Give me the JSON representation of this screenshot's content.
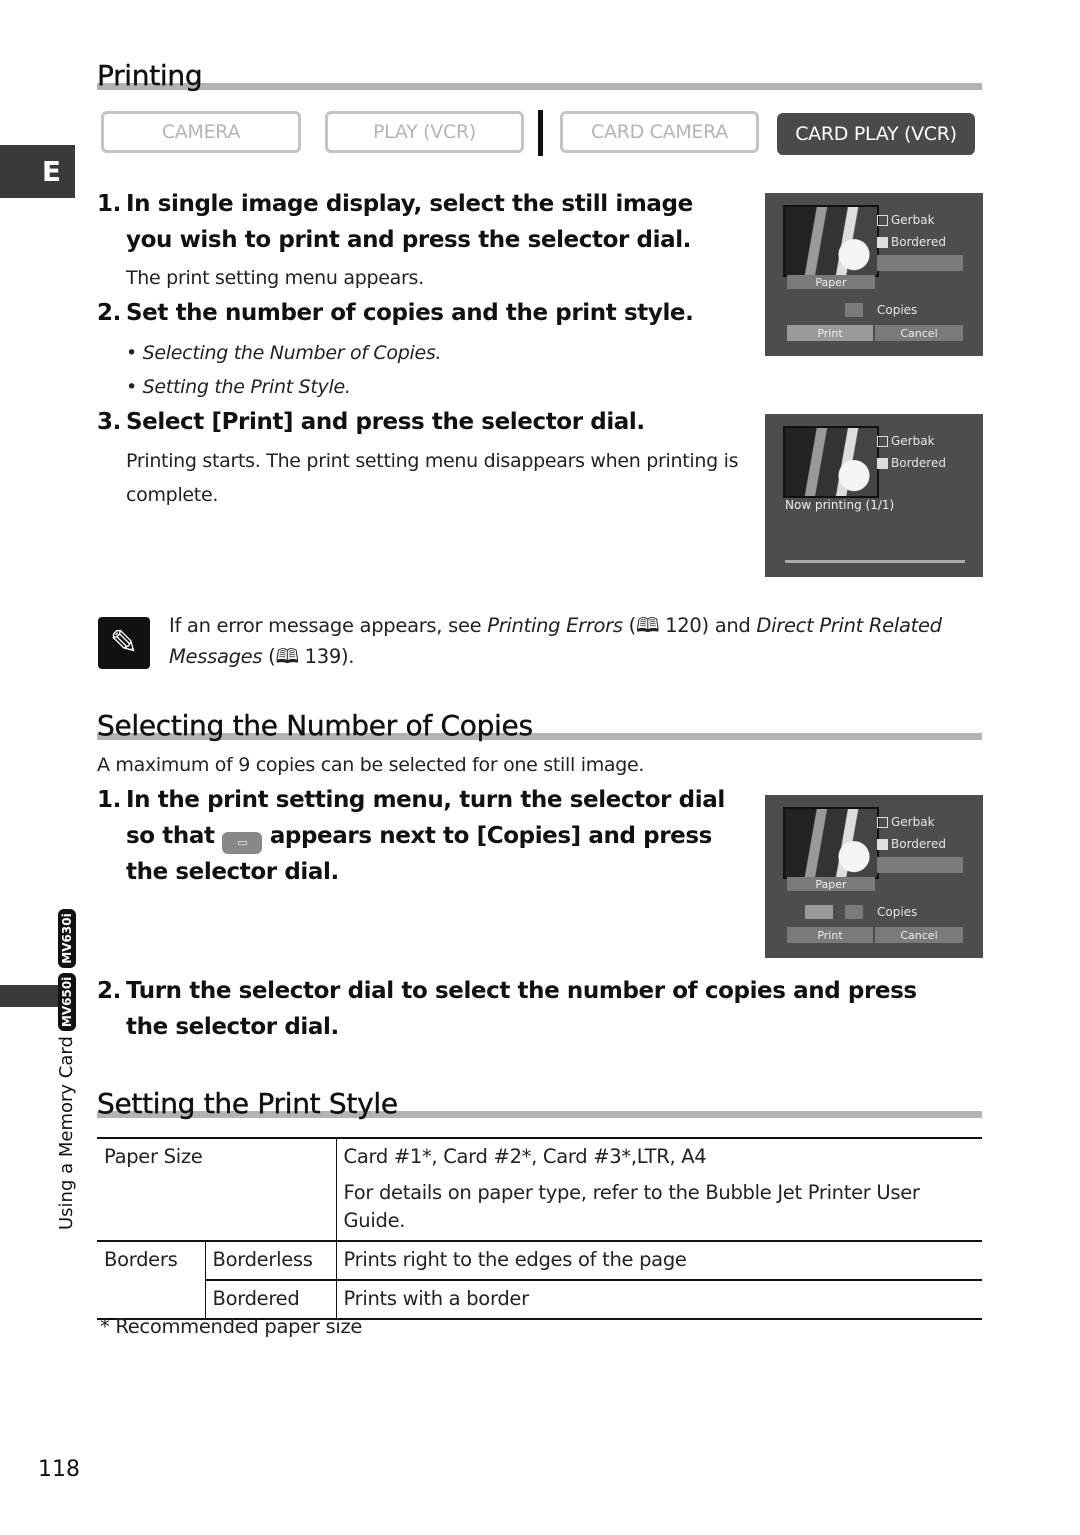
{
  "page": {
    "language_tab": "E",
    "side_label": "Using a Memory Card",
    "model_badges": [
      "MV650i",
      "MV630i"
    ],
    "page_number": "118"
  },
  "printing": {
    "title": "Printing",
    "modes": [
      {
        "label": "CAMERA",
        "active": false
      },
      {
        "label": "PLAY (VCR)",
        "active": false
      },
      {
        "label": "CARD CAMERA",
        "active": false
      },
      {
        "label": "CARD PLAY (VCR)",
        "active": true
      }
    ],
    "steps": [
      {
        "num": "1.",
        "text": "In single image display, select the still image you wish to print and press the selector dial.",
        "detail": "The print setting menu appears."
      },
      {
        "num": "2.",
        "text": "Set the number of copies and the print style.",
        "bullets": [
          "Selecting the Number of Copies.",
          "Setting the Print Style."
        ]
      },
      {
        "num": "3.",
        "text": "Select [Print] and press the selector dial.",
        "detail": "Printing starts. The print setting menu disappears when printing is complete."
      }
    ],
    "screens": [
      {
        "options": [
          "Gerbak",
          "Bordered"
        ],
        "bars": [
          "Paper",
          "Copies",
          "Print",
          "Cancel"
        ]
      },
      {
        "options": [
          "Gerbak",
          "Bordered"
        ],
        "message": "Now printing (1/1)"
      }
    ],
    "note": {
      "prefix": "If an error message appears, see ",
      "ref1_title": "Printing Errors",
      "ref1_page": "120",
      "middle": ") and ",
      "ref2_title": "Direct Print Related Messages",
      "ref2_page": "139",
      "suffix": ")."
    }
  },
  "copies": {
    "title": "Selecting the Number of Copies",
    "intro": "A maximum of 9 copies can be selected for one still image.",
    "step1": {
      "num": "1.",
      "text_a": "In the print setting menu, turn the selector dial so that",
      "text_b": "appears next to [Copies] and press the selector dial."
    },
    "step2": {
      "num": "2.",
      "text": "Turn the selector dial to select the number of copies and press the selector dial."
    },
    "screen": {
      "options": [
        "Gerbak",
        "Bordered"
      ],
      "bars": [
        "Paper",
        "Copies",
        "Print",
        "Cancel"
      ]
    }
  },
  "style": {
    "title": "Setting the Print Style",
    "table": {
      "paper_size_label": "Paper Size",
      "paper_size_values": "Card #1*, Card #2*, Card #3*,LTR, A4",
      "paper_size_detail": "For details on paper type, refer to the Bubble Jet Printer User Guide.",
      "borders_label": "Borders",
      "rows": [
        {
          "option": "Borderless",
          "desc": "Prints right to the edges of the page"
        },
        {
          "option": "Bordered",
          "desc": "Prints with a border"
        }
      ]
    },
    "footnote": "* Recommended paper size"
  }
}
